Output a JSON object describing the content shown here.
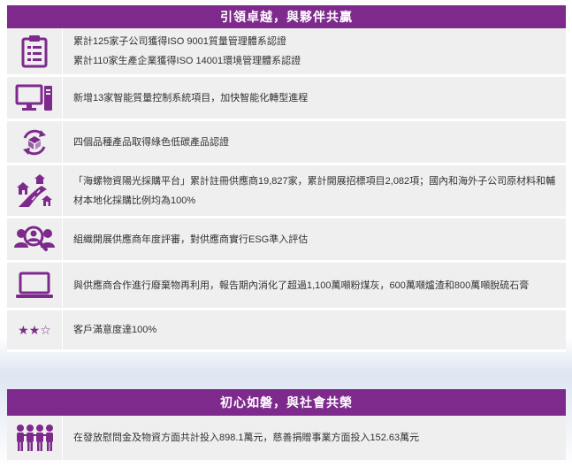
{
  "section1": {
    "title": "引領卓越，與夥伴共贏",
    "rows": [
      {
        "icon": "clipboard-checklist-icon",
        "lines": [
          "累計125家子公司獲得ISO 9001質量管理體系認證",
          "累計110家生產企業獲得ISO 14001環境管理體系認證"
        ]
      },
      {
        "icon": "desktop-computer-icon",
        "lines": [
          "新增13家智能質量控制系統項目，加快智能化轉型進程"
        ]
      },
      {
        "icon": "recycle-box-icon",
        "lines": [
          "四個品種產品取得綠色低碳產品認證"
        ]
      },
      {
        "icon": "village-road-icon",
        "lines": [
          "「海螺物資陽光採購平台」累計註冊供應商19,827家，累計開展招標項目2,082項；國內和海外子公司原材料和輔材本地化採購比例均為100%"
        ]
      },
      {
        "icon": "people-search-icon",
        "lines": [
          "組織開展供應商年度評審，對供應商實行ESG準入評估"
        ]
      },
      {
        "icon": "laptop-icon",
        "lines": [
          "與供應商合作進行廢棄物再利用，報告期內消化了超過1,100萬噸粉煤灰，600萬噸爐渣和800萬噸脫硫石膏"
        ]
      },
      {
        "icon": "rating-stars-icon",
        "stars": "★★☆",
        "lines": [
          "客戶滿意度達100%"
        ]
      }
    ]
  },
  "section2": {
    "title": "初心如磐，與社會共榮",
    "rows": [
      {
        "icon": "people-group-icon",
        "lines": [
          "在發放慰問金及物資方面共計投入898.1萬元，慈善捐贈事業方面投入152.63萬元"
        ]
      }
    ]
  },
  "colors": {
    "accent": "#7d2a8c",
    "row_bg": "#efefef"
  }
}
